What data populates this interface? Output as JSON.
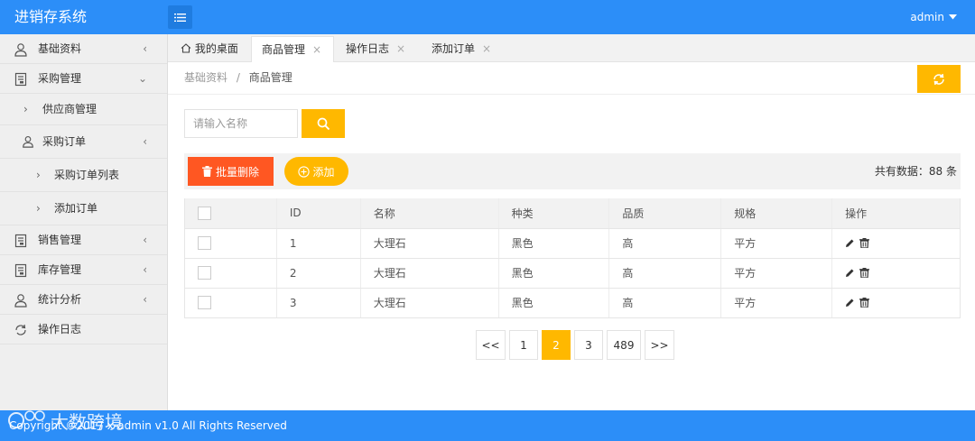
{
  "app": {
    "title": "进销存系统",
    "user": "admin"
  },
  "colors": {
    "primary": "#2c8ef8",
    "warm": "#ffb800",
    "danger": "#ff5722"
  },
  "sidebar": {
    "items": [
      {
        "label": "基础资料",
        "icon": "user-icon",
        "arrow": "<"
      },
      {
        "label": "采购管理",
        "icon": "doc-icon",
        "arrow": "v"
      },
      {
        "label": "供应商管理"
      },
      {
        "label": "采购订单",
        "icon": "user-icon",
        "arrow": "<"
      },
      {
        "label": "采购订单列表"
      },
      {
        "label": "添加订单"
      },
      {
        "label": "销售管理",
        "icon": "doc-icon",
        "arrow": "<"
      },
      {
        "label": "库存管理",
        "icon": "doc-icon",
        "arrow": "<"
      },
      {
        "label": "统计分析",
        "icon": "user-icon",
        "arrow": "<"
      },
      {
        "label": "操作日志",
        "icon": "refresh-circle-icon"
      }
    ]
  },
  "tabs": [
    {
      "label": "我的桌面",
      "icon": "home-icon"
    },
    {
      "label": "商品管理",
      "close": "×"
    },
    {
      "label": "操作日志",
      "close": "×"
    },
    {
      "label": "添加订单",
      "close": "×"
    }
  ],
  "breadcrumb": {
    "parent": "基础资料",
    "sep": "/",
    "current": "商品管理"
  },
  "search": {
    "placeholder": "请输入名称"
  },
  "toolbar": {
    "delete_label": "批量删除",
    "add_label": "添加",
    "total": "共有数据：88 条"
  },
  "table": {
    "headers": [
      "",
      "ID",
      "名称",
      "种类",
      "品质",
      "规格",
      "操作"
    ],
    "rows": [
      {
        "id": "1",
        "name": "大理石",
        "kind": "黑色",
        "quality": "高",
        "spec": "平方"
      },
      {
        "id": "2",
        "name": "大理石",
        "kind": "黑色",
        "quality": "高",
        "spec": "平方"
      },
      {
        "id": "3",
        "name": "大理石",
        "kind": "黑色",
        "quality": "高",
        "spec": "平方"
      }
    ]
  },
  "pagination": {
    "items": [
      "<<",
      "1",
      "2",
      "3",
      "489",
      ">>"
    ],
    "current": "2"
  },
  "footer": {
    "copyright": "Copyright ©2017 x-admin v1.0 All Rights Reserved",
    "watermark": "大数跨境"
  }
}
